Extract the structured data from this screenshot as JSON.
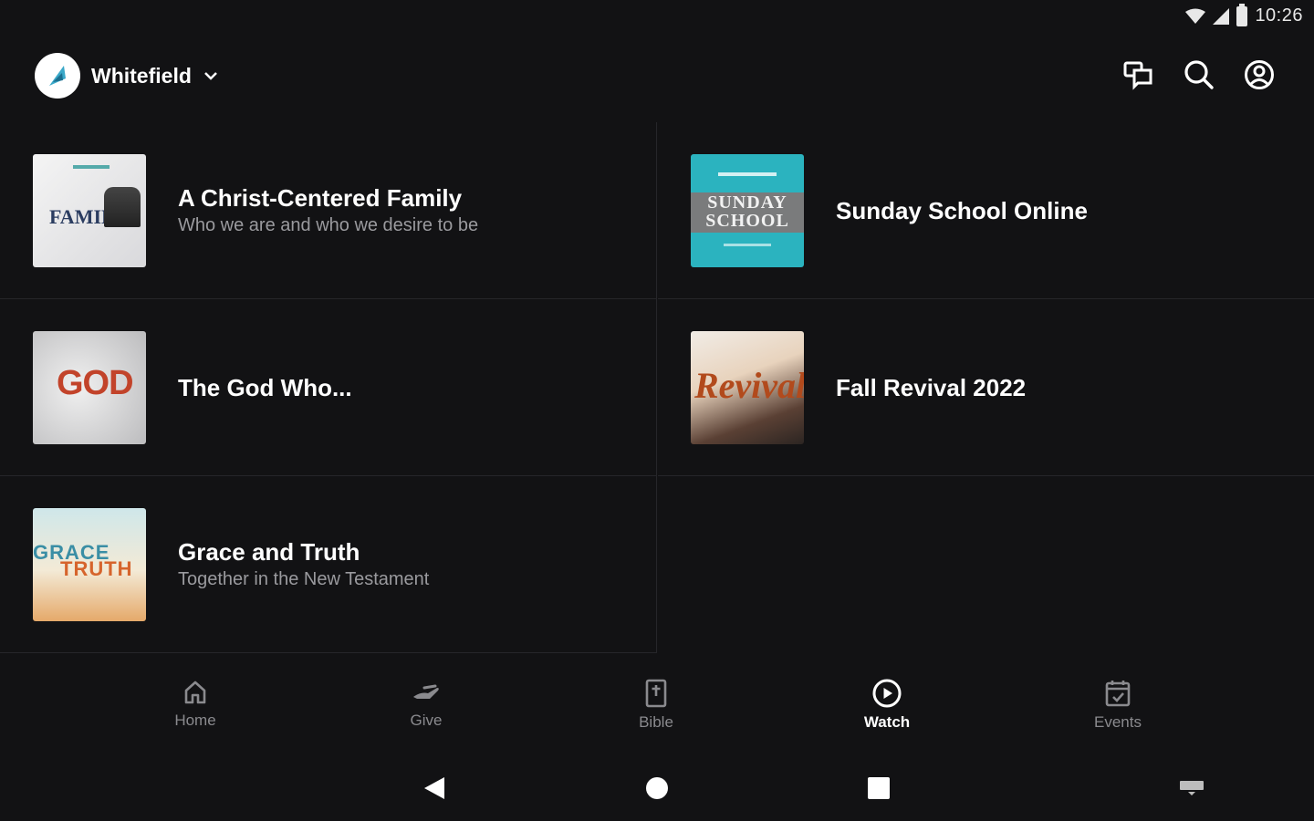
{
  "status_bar": {
    "time": "10:26"
  },
  "header": {
    "org_name": "Whitefield"
  },
  "series": [
    {
      "title": "A Christ-Centered Family",
      "subtitle": "Who we are and who we desire to be",
      "thumb_text": "FAMILY"
    },
    {
      "title": "Sunday School Online",
      "subtitle": "",
      "thumb_text_1": "SUNDAY",
      "thumb_text_2": "SCHOOL"
    },
    {
      "title": "The God Who...",
      "subtitle": "",
      "thumb_text": "GOD"
    },
    {
      "title": "Fall Revival 2022",
      "subtitle": "",
      "thumb_text": "Revival"
    },
    {
      "title": "Grace and Truth",
      "subtitle": "Together in the New Testament",
      "thumb_text_1": "GRACE",
      "thumb_text_2": "TRUTH"
    }
  ],
  "bottom_nav": {
    "items": [
      {
        "label": "Home",
        "icon": "home-icon"
      },
      {
        "label": "Give",
        "icon": "give-icon"
      },
      {
        "label": "Bible",
        "icon": "bible-icon"
      },
      {
        "label": "Watch",
        "icon": "play-circle-icon",
        "active": true
      },
      {
        "label": "Events",
        "icon": "calendar-check-icon"
      }
    ]
  },
  "colors": {
    "background": "#121214",
    "divider": "#26262a",
    "inactive": "#8a8a8e",
    "active": "#ffffff"
  }
}
